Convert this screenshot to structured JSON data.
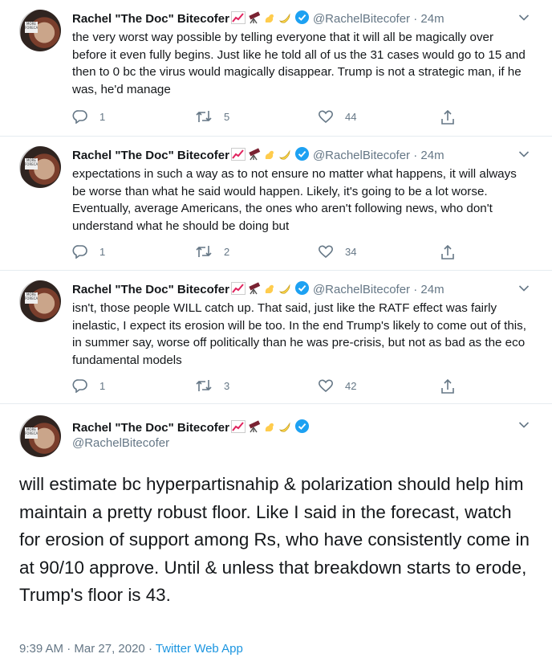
{
  "author": {
    "name": "Rachel \"The Doc\" Bitecofer",
    "handle": "@RachelBitecofer",
    "emojis": [
      "chart-increasing-emoji",
      "telescope-emoji",
      "bicep-emoji",
      "banana-emoji"
    ],
    "verified": true,
    "avatar_sign": "MORE FORECAST"
  },
  "replies": [
    {
      "time": "24m",
      "text": "the very worst way possible by telling everyone that it will all be magically over before it even fully begins. Just like he told all of us the 31 cases would go to 15 and then to 0 bc the virus would magically disappear. Trump is not a strategic man, if he was, he'd manage",
      "reply_count": "1",
      "retweet_count": "5",
      "like_count": "44"
    },
    {
      "time": "24m",
      "text": "expectations in such a way as to not ensure no matter what happens, it will always be worse than what he said would happen. Likely, it's going to be a lot worse. Eventually, average Americans, the ones who aren't following news, who don't understand what he should be doing but",
      "reply_count": "1",
      "retweet_count": "2",
      "like_count": "34"
    },
    {
      "time": "24m",
      "text": "isn't, those people WILL catch up. That said, just like the RATF effect was fairly inelastic, I expect its erosion will be too. In the end Trump's likely to come out of this, in summer say, worse off politically than he was pre-crisis, but not as bad as the eco fundamental models",
      "reply_count": "1",
      "retweet_count": "3",
      "like_count": "42"
    }
  ],
  "main_tweet": {
    "text": "will estimate bc hyperpartisnahip & polarization should help him maintain a pretty robust floor. Like I said in the forecast, watch for erosion of support among Rs, who have consistently come in at 90/10 approve. Until & unless that breakdown starts to erode, Trump's floor is 43.",
    "time": "9:39 AM",
    "separator": "·",
    "date": "Mar 27, 2020",
    "app": "Twitter Web App"
  },
  "colors": {
    "text": "#14171a",
    "secondary": "#657786",
    "link": "#1b95e0",
    "verified": "#1da1f2",
    "divider": "#e6ecf0"
  }
}
